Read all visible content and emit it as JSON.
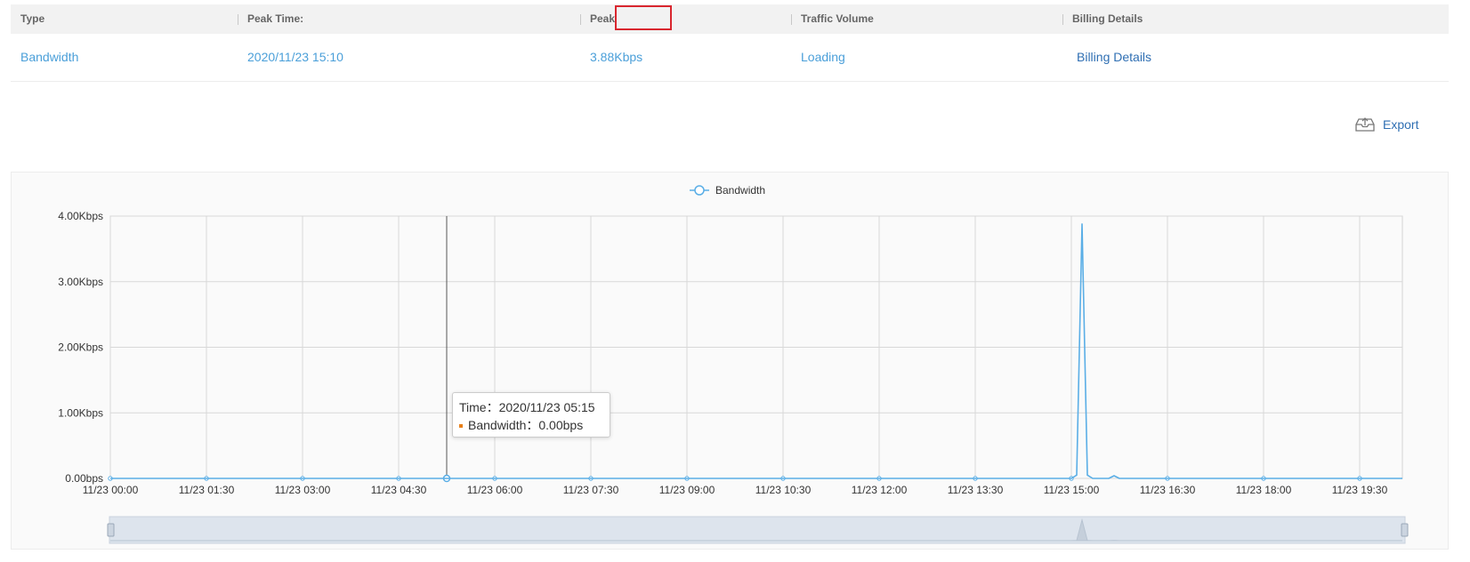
{
  "table": {
    "headers": [
      {
        "label": "Type"
      },
      {
        "label": "Peak Time:"
      },
      {
        "label": "Peak"
      },
      {
        "label": "Traffic Volume"
      },
      {
        "label": "Billing Details"
      }
    ],
    "row": {
      "type": "Bandwidth",
      "peak_time": "2020/11/23 15:10",
      "peak": "3.88Kbps",
      "traffic_volume": "Loading",
      "billing_details": "Billing Details"
    }
  },
  "export_label": "Export",
  "colors": {
    "series": "#5aaee6",
    "highlight": "#d9262e",
    "link": "#4a9fd9",
    "link_dark": "#2f6fb3",
    "tooltip_marker": "#e8801a"
  },
  "icons": {
    "export": "cloud-upload-icon"
  },
  "chart_data": {
    "type": "line",
    "legend": [
      "Bandwidth"
    ],
    "legend_position": "top-center",
    "ylabels": [
      "0.00bps",
      "1.00Kbps",
      "2.00Kbps",
      "3.00Kbps",
      "4.00Kbps"
    ],
    "ylim": [
      0,
      4
    ],
    "yunit": "Kbps",
    "xlabels": [
      "11/23 00:00",
      "11/23 01:30",
      "11/23 03:00",
      "11/23 04:30",
      "11/23 06:00",
      "11/23 07:30",
      "11/23 09:00",
      "11/23 10:30",
      "11/23 12:00",
      "11/23 13:30",
      "11/23 15:00",
      "11/23 16:30",
      "11/23 18:00",
      "11/23 19:30"
    ],
    "x_minutes_range": [
      0,
      1210
    ],
    "grid": true,
    "series": [
      {
        "name": "Bandwidth",
        "points": [
          {
            "t": 0,
            "v": 0
          },
          {
            "t": 900,
            "v": 0
          },
          {
            "t": 905,
            "v": 0.05
          },
          {
            "t": 910,
            "v": 3.88
          },
          {
            "t": 915,
            "v": 0.05
          },
          {
            "t": 920,
            "v": 0
          },
          {
            "t": 935,
            "v": 0
          },
          {
            "t": 940,
            "v": 0.04
          },
          {
            "t": 945,
            "v": 0
          },
          {
            "t": 1210,
            "v": 0
          }
        ]
      }
    ],
    "cursor_minutes": 315,
    "tooltip": {
      "time_label": "Time：2020/11/23 05:15",
      "value_label": "Bandwidth：0.00bps"
    }
  }
}
